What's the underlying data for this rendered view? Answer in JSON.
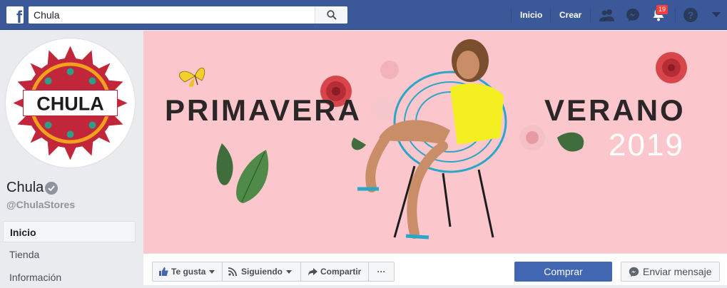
{
  "topbar": {
    "logo_letter": "f",
    "search_value": "Chula",
    "nav": {
      "home": "Inicio",
      "create": "Crear"
    },
    "notifications_count": "19"
  },
  "page": {
    "name": "Chula",
    "handle": "@ChulaStores",
    "logo_text": "CHULA"
  },
  "sidebar": {
    "items": [
      {
        "label": "Inicio"
      },
      {
        "label": "Tienda"
      },
      {
        "label": "Información"
      }
    ]
  },
  "cover": {
    "title_left": "PRIMAVERA",
    "title_right": "VERANO",
    "year": "2019"
  },
  "actions": {
    "like": "Te gusta",
    "follow": "Siguiendo",
    "share": "Compartir",
    "more": "···",
    "buy": "Comprar",
    "message": "Enviar mensaje"
  },
  "colors": {
    "brand": "#3b5998",
    "cover_bg": "#fcc6cd",
    "primary_button": "#4267b2"
  }
}
